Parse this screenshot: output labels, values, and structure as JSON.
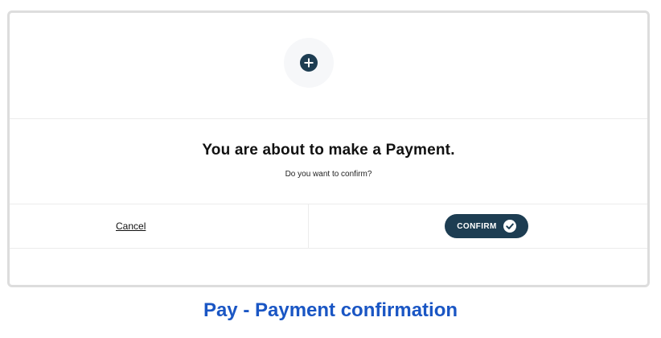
{
  "dialog": {
    "icon": "plus-circle-icon",
    "title": "You are about to make a Payment.",
    "subtitle": "Do you want to confirm?",
    "cancel_label": "Cancel",
    "confirm_label": "CONFIRM",
    "confirm_icon": "check-circle-icon"
  },
  "caption": "Pay - Payment confirmation",
  "colors": {
    "accent": "#1d3d52",
    "caption": "#1a56c4",
    "border": "#dddddd",
    "divider": "#ececec"
  }
}
